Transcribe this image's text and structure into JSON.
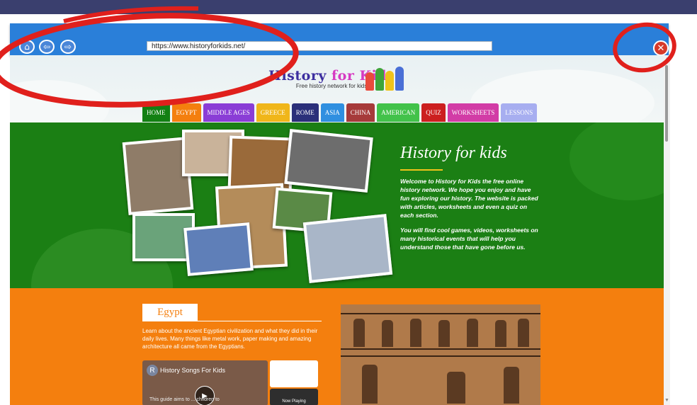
{
  "browser": {
    "url": "https://www.historyforkids.net/",
    "nav_buttons": [
      "home-icon",
      "back-arrow-icon",
      "forward-arrow-icon"
    ],
    "close_icon": "close-icon"
  },
  "site": {
    "logo_title_a": "History ",
    "logo_title_b": "for Kids",
    "logo_subtitle": "Free history network for kids",
    "nav": [
      {
        "label": "HOME",
        "color": "#138013"
      },
      {
        "label": "EGYPT",
        "color": "#f47f0e"
      },
      {
        "label": "MIDDLE AGES",
        "color": "#8a3dd6"
      },
      {
        "label": "GREECE",
        "color": "#f0b61a"
      },
      {
        "label": "ROME",
        "color": "#2b2f7a"
      },
      {
        "label": "ASIA",
        "color": "#2f8fe0"
      },
      {
        "label": "CHINA",
        "color": "#a63a3a"
      },
      {
        "label": "AMERICAN",
        "color": "#42c24a"
      },
      {
        "label": "QUIZ",
        "color": "#cc1f1f"
      },
      {
        "label": "WORKSHEETS",
        "color": "#d23ca6"
      },
      {
        "label": "LESSONS",
        "color": "#a7aef0"
      }
    ],
    "hero": {
      "title": "History for kids",
      "p1": "Welcome to History for Kids the free online history network. We hope you enjoy and have fun exploring our history. The website is packed with articles, worksheets and even a quiz on each section.",
      "p2": "You will find cool games, videos, worksheets on many historical events that will help you understand those that have gone before us."
    },
    "egypt": {
      "heading": "Egypt",
      "text": "Learn about the ancient Egyptian civilization and what they did in their daily lives. Many things like metal work, paper making and amazing architecture all came from the Egyptians.",
      "video_avatar": "R",
      "video_title": "History Songs For Kids",
      "video_caption": "This guide aims to ... children to",
      "now_playing": "Now Playing"
    }
  },
  "colors": {
    "hero_green": "#1b7f14",
    "orange": "#f47f0e",
    "toolbar_blue": "#2a7fd9",
    "annotation_red": "#e0201c"
  }
}
